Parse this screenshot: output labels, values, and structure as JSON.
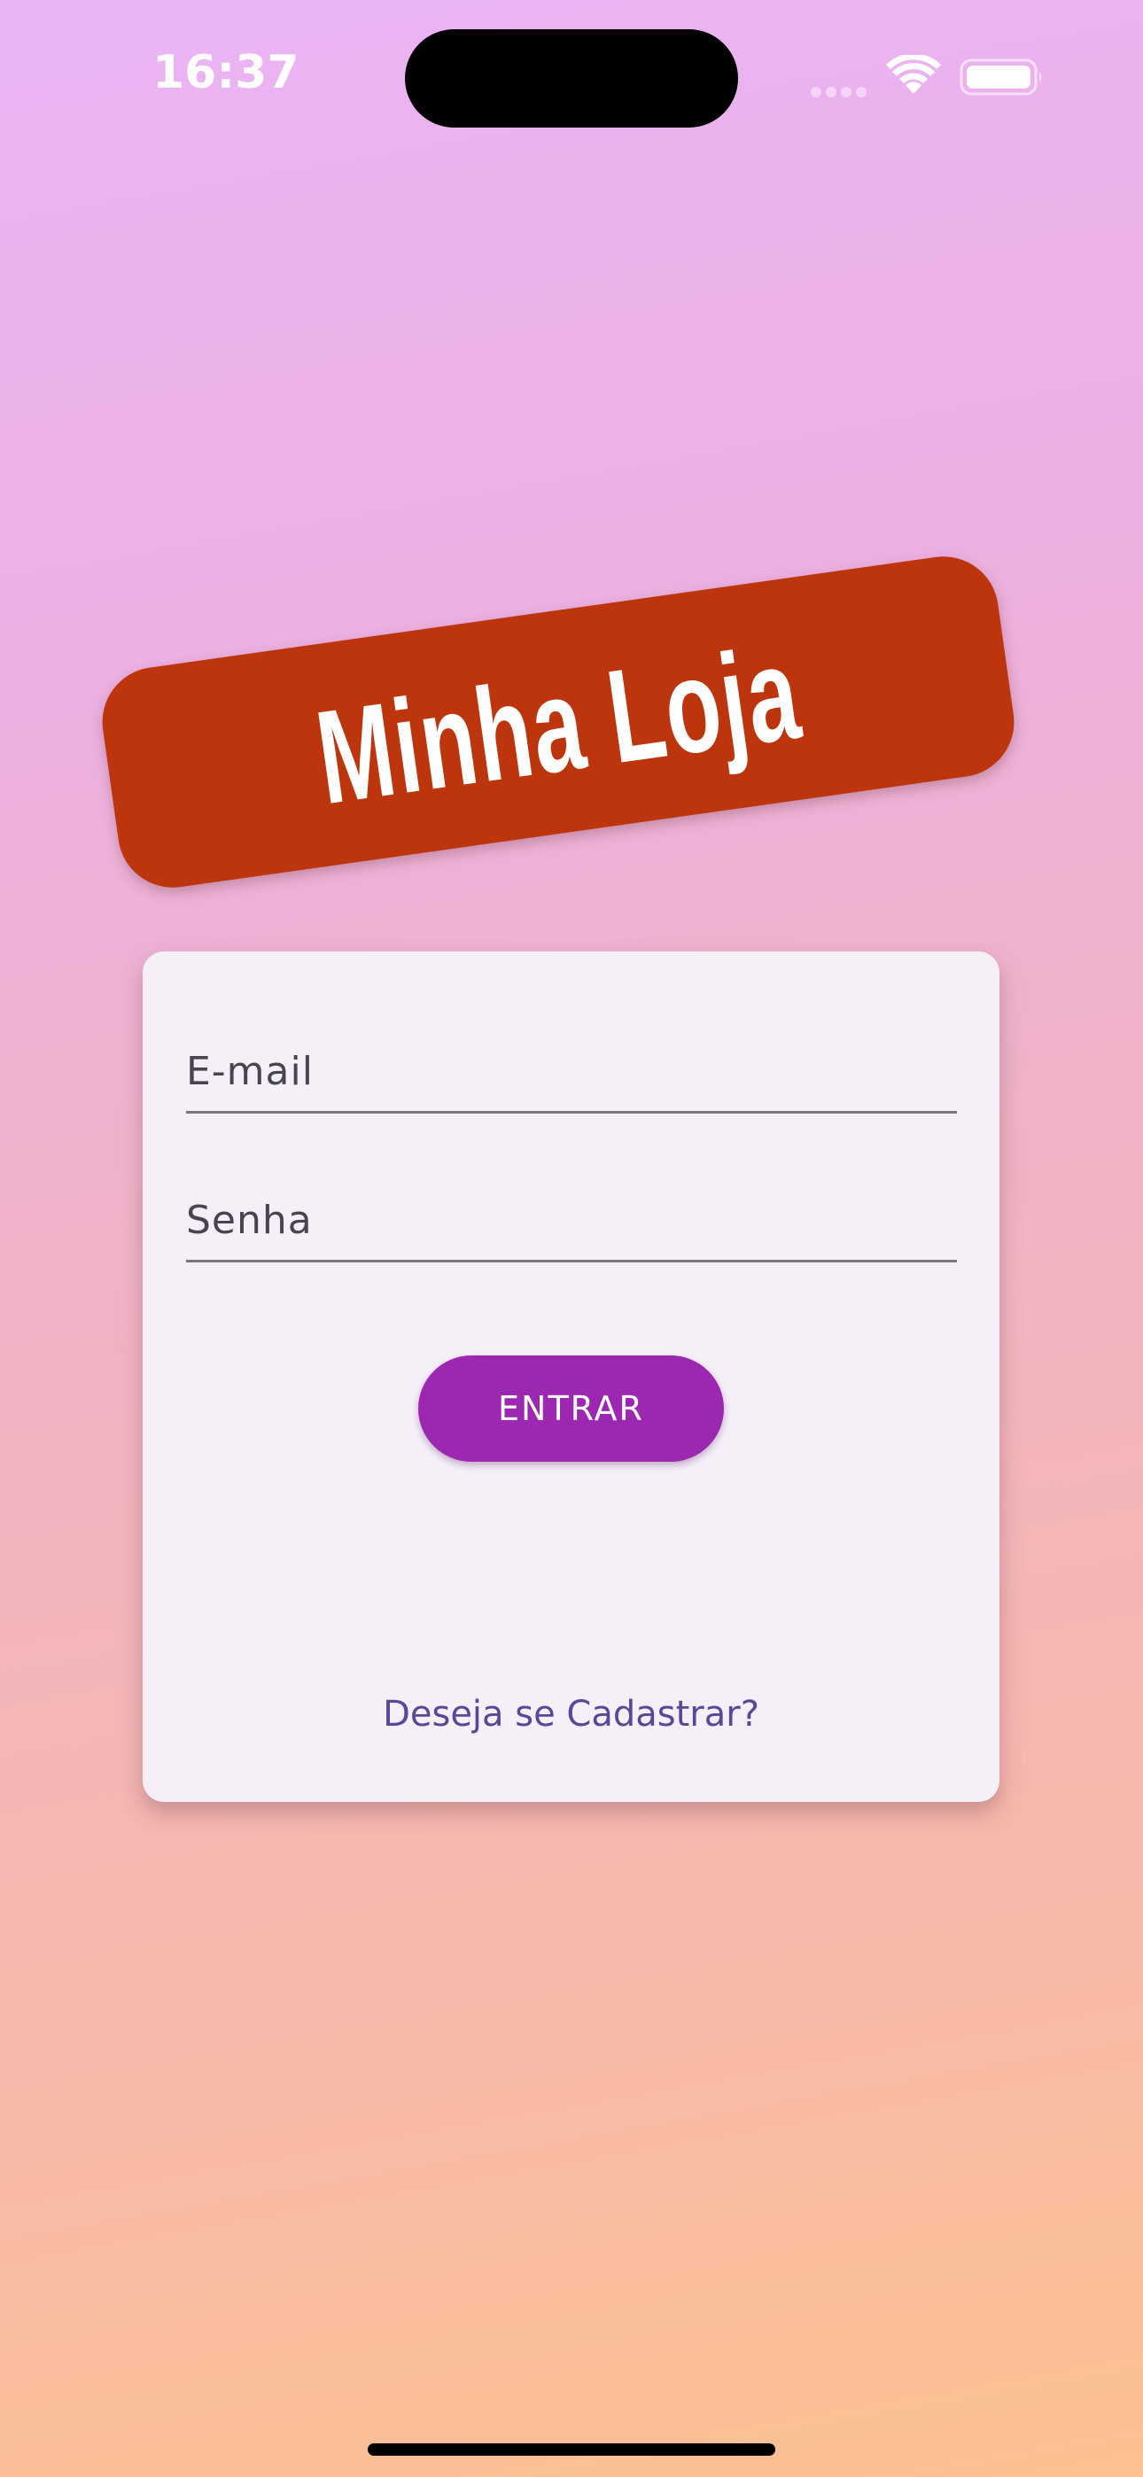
{
  "status_bar": {
    "time": "16:37",
    "icons": [
      "cellular-dots-icon",
      "wifi-icon",
      "battery-icon"
    ]
  },
  "logo": {
    "text": "Minha Loja",
    "background_color": "#bc350d",
    "text_color": "#ffffff"
  },
  "login_form": {
    "email": {
      "placeholder": "E-mail",
      "value": ""
    },
    "password": {
      "placeholder": "Senha",
      "value": ""
    },
    "submit_label": "ENTRAR",
    "register_link": "Deseja se Cadastrar?"
  },
  "colors": {
    "accent": "#9c27b0",
    "link": "#5b4697",
    "card_background": "#f5eff8",
    "gradient_top": "#ebb4f6",
    "gradient_bottom": "#fbc191"
  }
}
